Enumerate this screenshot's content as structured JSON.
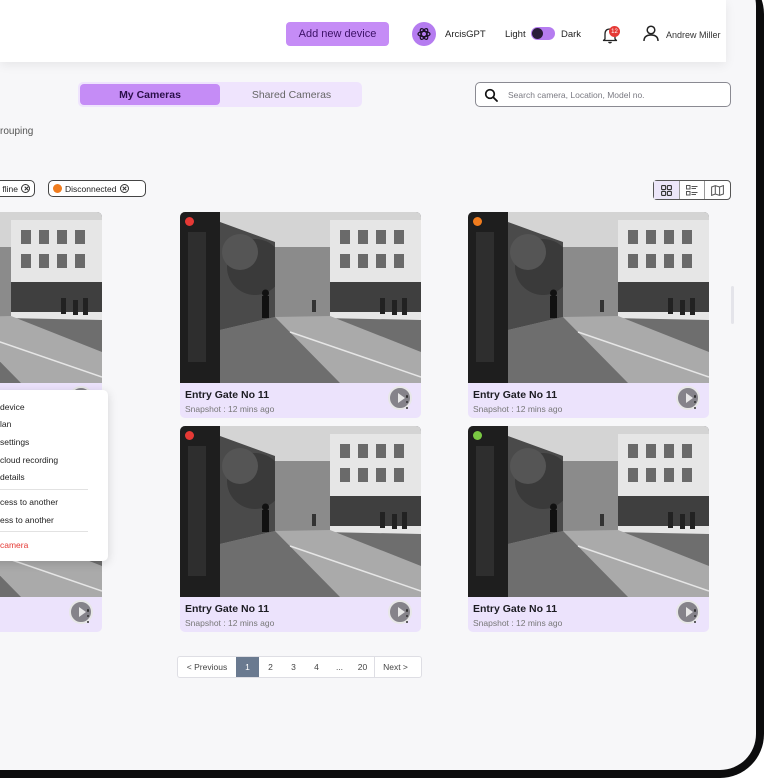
{
  "header": {
    "add_device_label": "Add new device",
    "assistant_name": "ArcisGPT",
    "theme_light_label": "Light",
    "theme_dark_label": "Dark",
    "notification_count": "12",
    "user_name": "Andrew Miller"
  },
  "tabs": {
    "my_cameras": "My Cameras",
    "shared_cameras": "Shared Cameras"
  },
  "search": {
    "placeholder": "Search camera, Location, Model no.",
    "value": ""
  },
  "grouping_label": "rouping",
  "filters": [
    {
      "label": "fline",
      "color": ""
    },
    {
      "label": "Disconnected",
      "color": "#f07c1e"
    }
  ],
  "views": [
    "grid-view-icon",
    "list-view-icon",
    "map-view-icon"
  ],
  "cards": [
    {
      "title": "Entry Gate No 11",
      "subtitle": "Snapshot : 12 mins ago",
      "status_color": "#e53935"
    },
    {
      "title": "Entry Gate No 11",
      "subtitle": "Snapshot : 12 mins ago",
      "status_color": "#f07c1e"
    },
    {
      "title": "Entry Gate No 11",
      "subtitle": "Snapshot : 12 mins ago",
      "status_color": "#e53935"
    },
    {
      "title": "Entry Gate No 11",
      "subtitle": "Snapshot : 12 mins ago",
      "status_color": "#7ac943"
    }
  ],
  "context_menu": {
    "items": [
      "device",
      "lan",
      "settings",
      "cloud recording",
      "details",
      "cess to another",
      "ess to another",
      "camera"
    ]
  },
  "pagination": {
    "prev": "< Previous",
    "pages": [
      "1",
      "2",
      "3",
      "4",
      "...",
      "20"
    ],
    "active": "1",
    "next": "Next >"
  },
  "colors": {
    "accent": "#c58cf6",
    "accent_light": "#ece3fc",
    "danger": "#e53935"
  }
}
